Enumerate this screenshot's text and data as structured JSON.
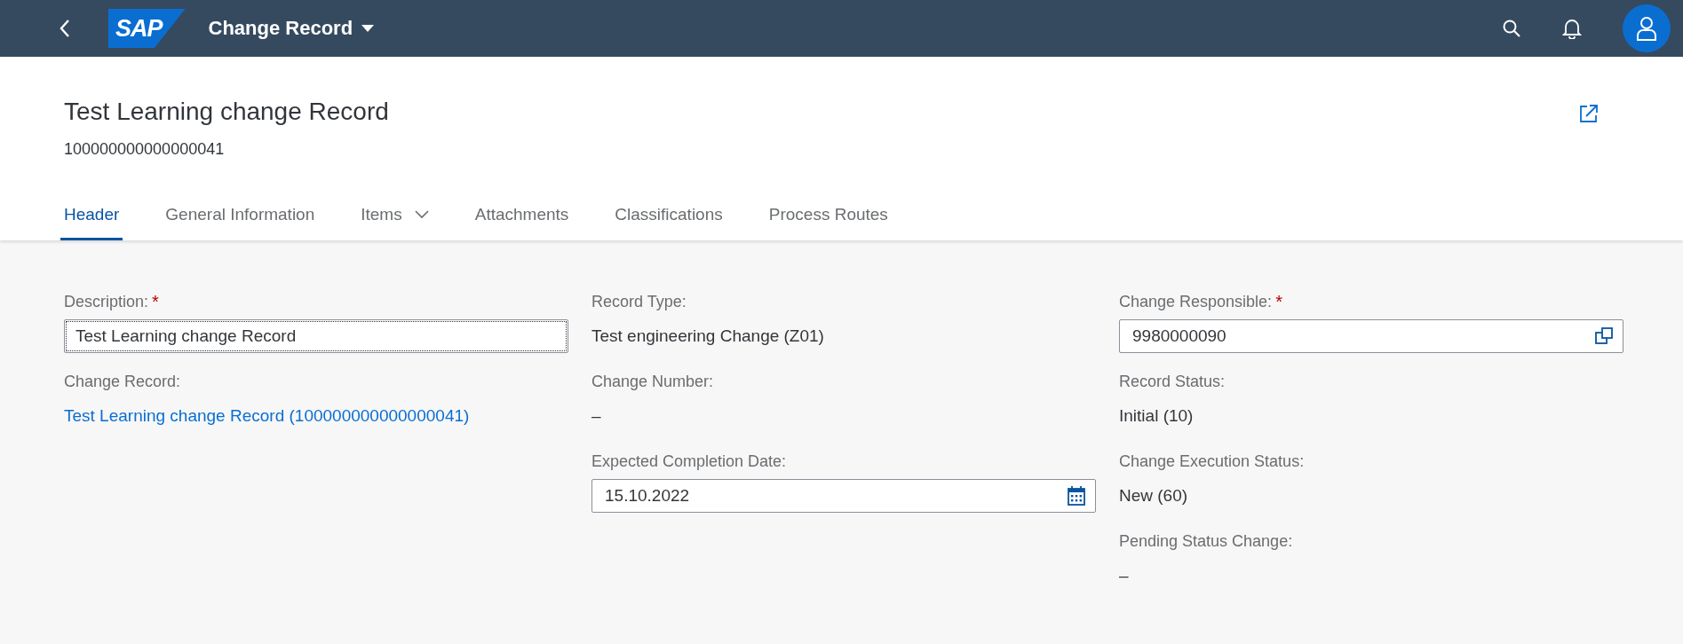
{
  "shell": {
    "title": "Change Record",
    "logo": "SAP"
  },
  "header": {
    "title": "Test Learning change Record",
    "subtitle": "100000000000000041"
  },
  "tabs": [
    {
      "label": "Header",
      "selected": true,
      "dropdown": false
    },
    {
      "label": "General Information",
      "selected": false,
      "dropdown": false
    },
    {
      "label": "Items",
      "selected": false,
      "dropdown": true
    },
    {
      "label": "Attachments",
      "selected": false,
      "dropdown": false
    },
    {
      "label": "Classifications",
      "selected": false,
      "dropdown": false
    },
    {
      "label": "Process Routes",
      "selected": false,
      "dropdown": false
    }
  ],
  "columns": [
    [
      {
        "label": "Description:",
        "kind": "input",
        "value": "Test Learning change Record",
        "focused": true,
        "required_mark": "*"
      },
      {
        "label": "Change Record:",
        "kind": "link",
        "value": "Test Learning change Record (100000000000000041)"
      }
    ],
    [
      {
        "label": "Record Type:",
        "kind": "text",
        "value": "Test engineering Change (Z01)"
      },
      {
        "label": "Change Number:",
        "kind": "text",
        "value": "–"
      },
      {
        "label": "Expected Completion Date:",
        "kind": "date",
        "value": "15.10.2022"
      }
    ],
    [
      {
        "label": "Change Responsible:",
        "kind": "valuehelp",
        "value": "9980000090",
        "required_mark": "*"
      },
      {
        "label": "Record Status:",
        "kind": "text",
        "value": "Initial (10)"
      },
      {
        "label": "Change Execution Status:",
        "kind": "text",
        "value": "New (60)"
      },
      {
        "label": "Pending Status Change:",
        "kind": "text",
        "value": "–"
      }
    ]
  ]
}
